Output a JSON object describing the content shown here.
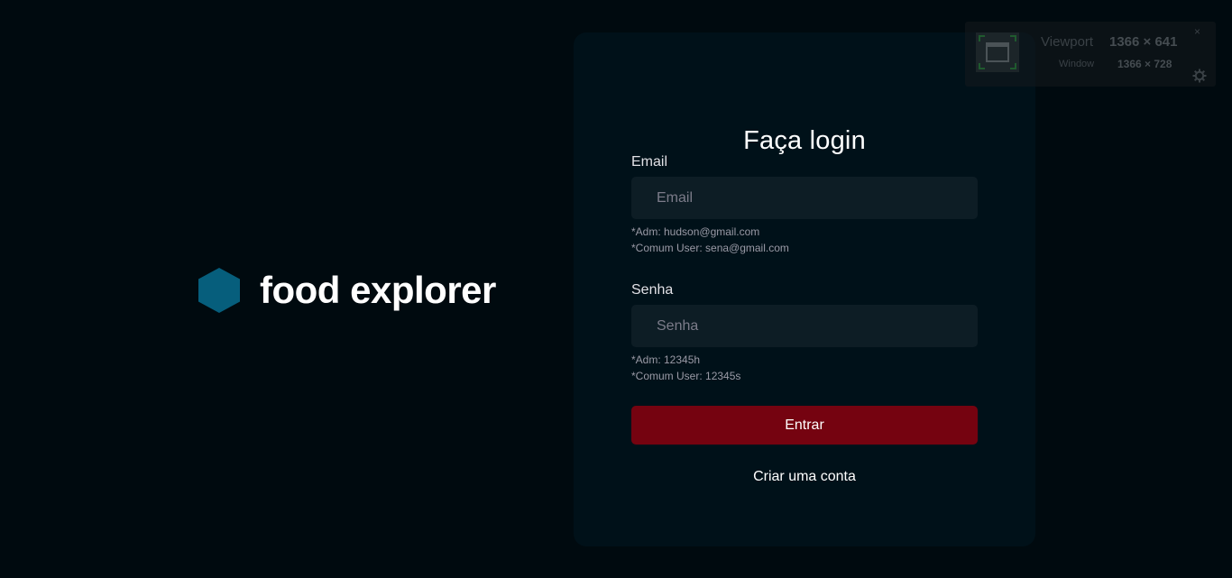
{
  "brand": {
    "name": "food explorer",
    "logo_icon": "hexagon-icon",
    "logo_color": "#065e7c"
  },
  "login": {
    "title": "Faça login",
    "email": {
      "label": "Email",
      "placeholder": "Email",
      "value": "",
      "hints": [
        "*Adm: hudson@gmail.com",
        "*Comum User: sena@gmail.com"
      ]
    },
    "password": {
      "label": "Senha",
      "placeholder": "Senha",
      "value": "",
      "hints": [
        "*Adm: 12345h",
        "*Comum User: 12345s"
      ]
    },
    "submit_label": "Entrar",
    "signup_label": "Criar uma conta"
  },
  "viewport_overlay": {
    "viewport_label": "Viewport",
    "viewport_value": "1366 × 641",
    "window_label": "Window",
    "window_value": "1366 × 728",
    "close_label": "×",
    "icons": [
      "viewport-icon",
      "close-icon",
      "gear-icon"
    ]
  },
  "colors": {
    "background": "#000a0f",
    "card": "#001119",
    "input": "#0d1d25",
    "button": "#750310",
    "accent": "#065e7c"
  }
}
